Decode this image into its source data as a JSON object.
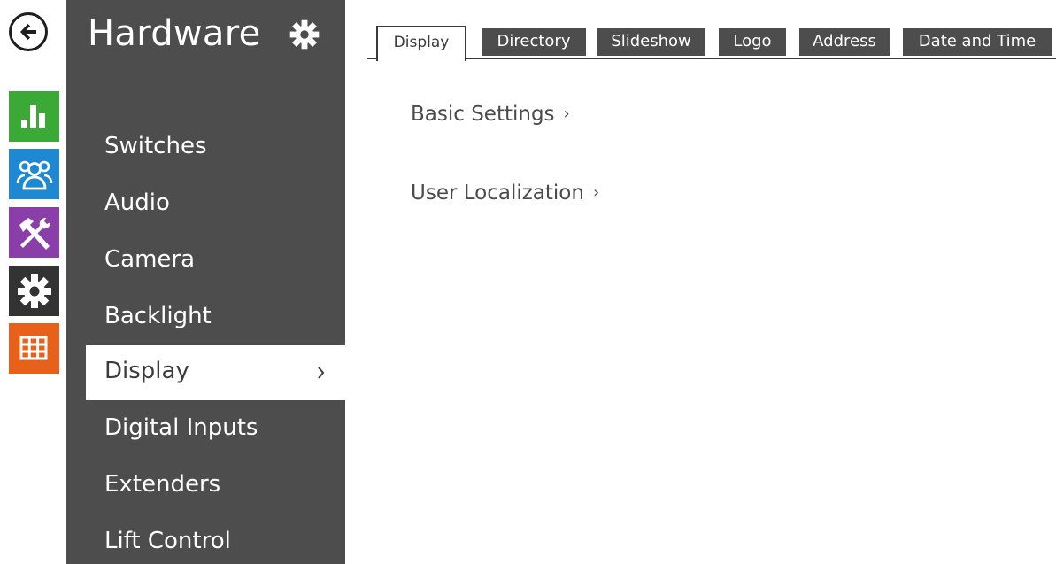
{
  "rail": {
    "back_icon": "arrow-left-icon",
    "tiles": [
      {
        "name": "status",
        "icon": "bar-chart-icon",
        "color": "#3aa935"
      },
      {
        "name": "users",
        "icon": "users-icon",
        "color": "#1e88d2"
      },
      {
        "name": "services",
        "icon": "tools-icon",
        "color": "#8a3ea8"
      },
      {
        "name": "hardware",
        "icon": "gear-icon",
        "color": "#333333"
      },
      {
        "name": "system",
        "icon": "grid-icon",
        "color": "#e8611a"
      }
    ]
  },
  "menu": {
    "title": "Hardware",
    "title_icon": "gear-icon",
    "items": [
      {
        "label": "Switches"
      },
      {
        "label": "Audio"
      },
      {
        "label": "Camera"
      },
      {
        "label": "Backlight"
      },
      {
        "label": "Display",
        "active": true,
        "chevron": "›"
      },
      {
        "label": "Digital Inputs"
      },
      {
        "label": "Extenders"
      },
      {
        "label": "Lift Control"
      }
    ]
  },
  "tabs": [
    {
      "label": "Display",
      "active": true
    },
    {
      "label": "Directory"
    },
    {
      "label": "Slideshow"
    },
    {
      "label": "Logo"
    },
    {
      "label": "Address"
    },
    {
      "label": "Date and Time"
    }
  ],
  "content": {
    "links": [
      {
        "label": "Basic Settings",
        "arrow": "›"
      },
      {
        "label": "User Localization",
        "arrow": "›"
      }
    ]
  },
  "colors": {
    "panel": "#4d4d4d",
    "accent_dark": "#3a3a3a"
  }
}
